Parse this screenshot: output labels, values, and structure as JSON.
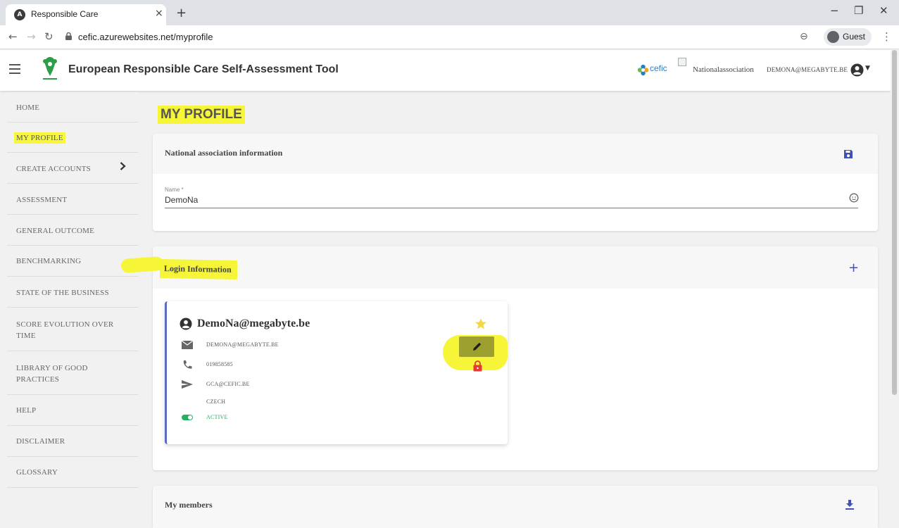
{
  "browser": {
    "tab_title": "Responsible Care",
    "tab_close": "×",
    "new_tab": "+",
    "url": "cefic.azurewebsites.net/myprofile",
    "profile_label": "Guest",
    "window_controls": [
      "−",
      "❐",
      "✕"
    ]
  },
  "header": {
    "app_title": "European Responsible Care Self-Assessment Tool",
    "partner_logo_text": "cefic",
    "association": "Nationalassociation",
    "user_email": "DEMONA@MEGABYTE.BE"
  },
  "sidebar": {
    "items": [
      {
        "label": "HOME"
      },
      {
        "label": "MY PROFILE"
      },
      {
        "label": "CREATE ACCOUNTS"
      },
      {
        "label": "ASSESSMENT"
      },
      {
        "label": "GENERAL OUTCOME"
      },
      {
        "label": "BENCHMARKING"
      },
      {
        "label": "STATE OF THE BUSINESS"
      },
      {
        "label": "SCORE EVOLUTION OVER TIME"
      },
      {
        "label": "LIBRARY OF GOOD PRACTICES"
      },
      {
        "label": "HELP"
      },
      {
        "label": "DISCLAIMER"
      },
      {
        "label": "GLOSSARY"
      }
    ]
  },
  "main": {
    "page_title": "MY PROFILE",
    "national_association": {
      "title": "National association information",
      "name_label": "Name *",
      "name_value": "DemoNa"
    },
    "login_information": {
      "title": "Login Information",
      "add_label": "+"
    },
    "user_card": {
      "username": "DemoNa@megabyte.be",
      "email": "DEMONA@MEGABYTE.BE",
      "phone": "019858585",
      "send_to": "GCA@CEFIC.BE",
      "country": "CZECH",
      "status": "ACTIVE"
    },
    "my_members": {
      "title": "My members"
    }
  },
  "colors": {
    "highlight": "#f6f537",
    "accent": "#3f51b5",
    "active_green": "#27ae60",
    "lock_red": "#e53935",
    "star_gold": "#f3d74b"
  }
}
